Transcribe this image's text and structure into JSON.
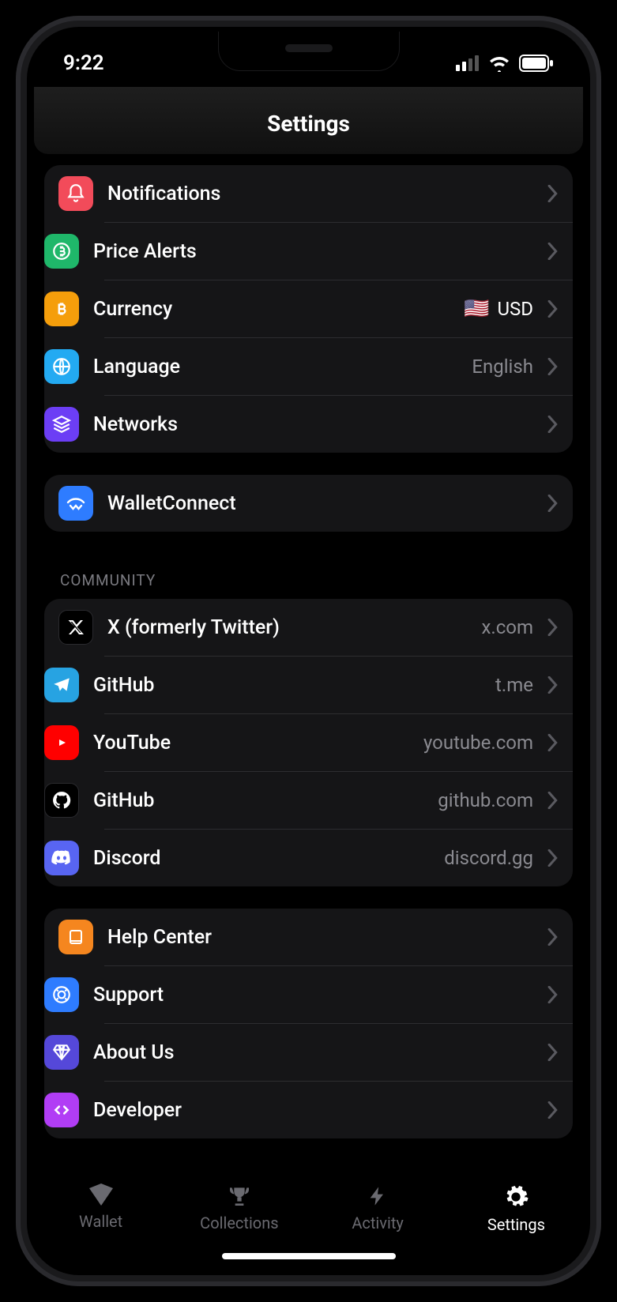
{
  "status": {
    "time": "9:22"
  },
  "header": {
    "title": "Settings"
  },
  "group1": {
    "items": [
      {
        "label": "Notifications",
        "value": "",
        "icon": "bell-icon",
        "color": "#f24b5a"
      },
      {
        "label": "Price Alerts",
        "value": "",
        "icon": "bitcoin-alert-icon",
        "color": "#1fb76a"
      },
      {
        "label": "Currency",
        "value": "USD",
        "flag": "🇺🇸",
        "icon": "bitcoin-icon",
        "color": "#f59e0b"
      },
      {
        "label": "Language",
        "value": "English",
        "icon": "globe-icon",
        "color": "#23aaf2"
      },
      {
        "label": "Networks",
        "value": "",
        "icon": "layers-icon",
        "color": "#6c3ef5"
      }
    ]
  },
  "group2": {
    "items": [
      {
        "label": "WalletConnect",
        "value": "",
        "icon": "walletconnect-icon",
        "color": "#2e7cff"
      }
    ]
  },
  "community_header": "COMMUNITY",
  "group3": {
    "items": [
      {
        "label": "X (formerly Twitter)",
        "value": "x.com",
        "icon": "x-icon",
        "color": "#000000"
      },
      {
        "label": "GitHub",
        "value": "t.me",
        "icon": "telegram-icon",
        "color": "#27a3e2"
      },
      {
        "label": "YouTube",
        "value": "youtube.com",
        "icon": "youtube-icon",
        "color": "#ff0000"
      },
      {
        "label": "GitHub",
        "value": "github.com",
        "icon": "github-icon",
        "color": "#000000"
      },
      {
        "label": "Discord",
        "value": "discord.gg",
        "icon": "discord-icon",
        "color": "#5865f2"
      }
    ]
  },
  "group4": {
    "items": [
      {
        "label": "Help Center",
        "value": "",
        "icon": "book-icon",
        "color": "#f5861f"
      },
      {
        "label": "Support",
        "value": "",
        "icon": "lifebuoy-icon",
        "color": "#2e7cff"
      },
      {
        "label": "About Us",
        "value": "",
        "icon": "diamond-icon",
        "color": "#5548d9"
      },
      {
        "label": "Developer",
        "value": "",
        "icon": "code-icon",
        "color": "#b13df5"
      }
    ]
  },
  "tabs": {
    "items": [
      {
        "label": "Wallet",
        "icon": "wallet-tab-icon",
        "active": false
      },
      {
        "label": "Collections",
        "icon": "trophy-tab-icon",
        "active": false
      },
      {
        "label": "Activity",
        "icon": "bolt-tab-icon",
        "active": false
      },
      {
        "label": "Settings",
        "icon": "gear-tab-icon",
        "active": true
      }
    ]
  }
}
